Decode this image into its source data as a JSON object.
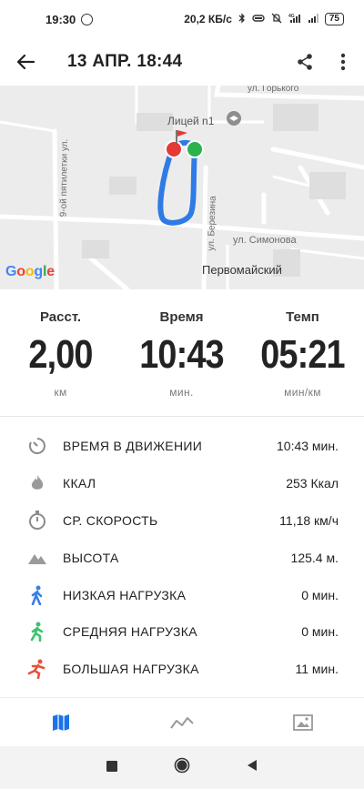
{
  "status_bar": {
    "time": "19:30",
    "network_speed": "20,2 КБ/с",
    "battery": "75"
  },
  "header": {
    "title": "13 АПР. 18:44"
  },
  "map": {
    "labels": {
      "street_gorky": "ул. Горького",
      "lyceum": "Лицей n1",
      "street_9piatiletki": "9-ой пятилетки ул.",
      "street_berezina": "ул. Березина",
      "street_simonova": "ул. Симонова",
      "district": "Первомайский"
    },
    "logo": "Google"
  },
  "summary": {
    "distance": {
      "label": "Расст.",
      "value": "2,00",
      "unit": "км"
    },
    "time": {
      "label": "Время",
      "value": "10:43",
      "unit": "мин."
    },
    "pace": {
      "label": "Темп",
      "value": "05:21",
      "unit": "мин/км"
    }
  },
  "stats": [
    {
      "icon": "moving-time-icon",
      "label": "ВРЕМЯ В ДВИЖЕНИИ",
      "value": "10:43 мин."
    },
    {
      "icon": "flame-icon",
      "label": "ККАЛ",
      "value": "253 Ккал"
    },
    {
      "icon": "stopwatch-icon",
      "label": "СР. СКОРОСТЬ",
      "value": "11,18 км/ч"
    },
    {
      "icon": "mountain-icon",
      "label": "ВЫСОТА",
      "value": "125.4 м."
    },
    {
      "icon": "walk-icon",
      "label": "НИЗКАЯ НАГРУЗКА",
      "value": "0 мин."
    },
    {
      "icon": "run-icon",
      "label": "СРЕДНЯЯ НАГРУЗКА",
      "value": "0 мин."
    },
    {
      "icon": "sprint-icon",
      "label": "БОЛЬШАЯ НАГРУЗКА",
      "value": "11 мин."
    }
  ],
  "colors": {
    "accent": "#1a73e8",
    "route": "#2f7be6",
    "low_load": "#3b7fe0",
    "mid_load": "#3cc26b",
    "high_load": "#e5533d",
    "start_marker": "#2bb24c",
    "end_marker": "#e53935"
  },
  "tabs": [
    {
      "icon": "map-icon",
      "active": true
    },
    {
      "icon": "chart-icon",
      "active": false
    },
    {
      "icon": "image-icon",
      "active": false
    }
  ]
}
